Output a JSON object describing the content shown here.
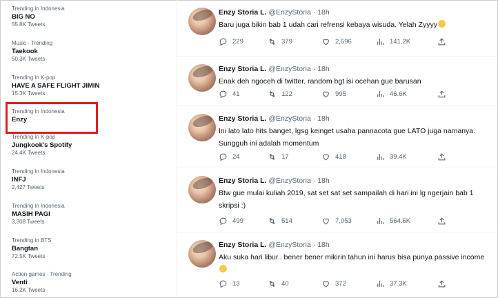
{
  "trends": [
    {
      "context": "Trending in Indonesia",
      "name": "BIG NO",
      "count": "55.8K Tweets"
    },
    {
      "context": "Music · Trending",
      "name": "Taekook",
      "count": "50.3K Tweets"
    },
    {
      "context": "Trending in K-pop",
      "name": "HAVE A SAFE FLIGHT JIMIN",
      "count": "15.3K Tweets"
    },
    {
      "context": "Trending in Indonesia",
      "name": "Enzy",
      "count": ""
    },
    {
      "context": "Trending in K-pop",
      "name": "Jungkook's Spotify",
      "count": "24.4K Tweets"
    },
    {
      "context": "Trending in Indonesia",
      "name": "INFJ",
      "count": "2,427 Tweets"
    },
    {
      "context": "Trending in Indonesia",
      "name": "MASIH PAGI",
      "count": "3,308 Tweets"
    },
    {
      "context": "Trending in BTS",
      "name": "Bangtan",
      "count": "72.5K Tweets"
    },
    {
      "context": "Action games · Trending",
      "name": "Venti",
      "count": "16.2K Tweets"
    }
  ],
  "tweets": [
    {
      "display_name": "Enzy Storia L.",
      "handle": "@EnzyStoria",
      "time": "18h",
      "text": "Baru juga bikin bab 1 udah cari refrensi kebaya wisuda. Yelah Zyyyy",
      "emoji": "rofl",
      "replies": "229",
      "retweets": "379",
      "likes": "2,596",
      "views": "141.2K"
    },
    {
      "display_name": "Enzy Storia L.",
      "handle": "@EnzyStoria",
      "time": "18h",
      "text": "Enak deh ngoceh di twitter. random bgt isi ocehan gue barusan",
      "replies": "41",
      "retweets": "122",
      "likes": "995",
      "views": "46.6K"
    },
    {
      "display_name": "Enzy Storia L.",
      "handle": "@EnzyStoria",
      "time": "18h",
      "text": "Ini lato lato hits banget, lgsg keinget usaha pannacota gue LATO juga namanya. Sungguh ini adalah momentum",
      "replies": "24",
      "retweets": "17",
      "likes": "418",
      "views": "39.4K"
    },
    {
      "display_name": "Enzy Storia L.",
      "handle": "@EnzyStoria",
      "time": "18h",
      "text": "Btw gue mulai kuliah 2019, sat set sat set sampailah di hari ini lg ngerjain bab 1 skripsi :)",
      "replies": "499",
      "retweets": "514",
      "likes": "7,053",
      "views": "564.6K"
    },
    {
      "display_name": "Enzy Storia L.",
      "handle": "@EnzyStoria",
      "time": "18h",
      "text": "Aku suka hari libur.. bener bener mikirin tahun ini harus bisa punya passive income",
      "emoji": "thinking",
      "replies": "13",
      "retweets": "40",
      "likes": "372",
      "views": "37.3K"
    }
  ],
  "colors": {
    "highlight": "#e01e1e",
    "secondary_text": "#536471",
    "primary_text": "#0f1419"
  }
}
